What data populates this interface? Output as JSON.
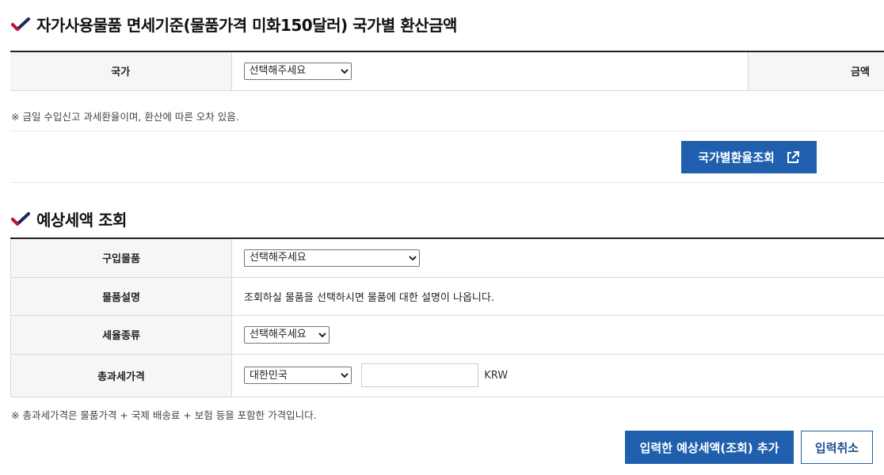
{
  "section1": {
    "title": "자가사용물품 면세기준(물품가격 미화150달러) 국가별 환산금액",
    "country_label": "국가",
    "country_select": "선택해주세요",
    "amount_label": "금액",
    "note": "※  금일 수입신고 과세환율이며, 환산에 따른 오차 있음.",
    "rate_button": "국가별환율조회"
  },
  "section2": {
    "title": "예상세액 조회",
    "rows": {
      "item_label": "구입물품",
      "item_select": "선택해주세요",
      "desc_label": "물품설명",
      "desc_text": "조회하실 물품을 선택하시면 물품에 대한 설명이 나옵니다.",
      "taxtype_label": "세율종류",
      "taxtype_select": "선택해주세요",
      "price_label": "총과세가격",
      "currency_select": "대한민국",
      "price_value": "",
      "price_unit": "KRW"
    },
    "note": "※  총과세가격은 물품가격 + 국제 배송료 + 보험 등을 포함한 가격입니다.",
    "add_button": "입력한 예상세액(조회) 추가",
    "cancel_button": "입력취소"
  },
  "colors": {
    "accent": "#1f5fad",
    "check_red": "#c8102e",
    "check_navy": "#1b2a5c"
  },
  "icons": [
    "check-icon",
    "external-link-icon"
  ]
}
